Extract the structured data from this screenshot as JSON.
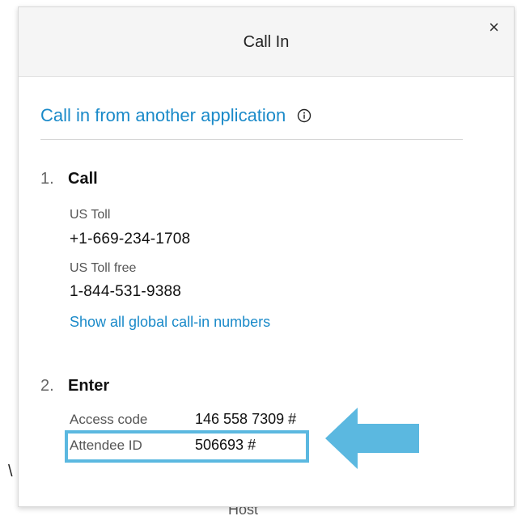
{
  "background": {
    "bottom_text": "Host"
  },
  "dialog": {
    "title": "Call In",
    "close_glyph": "×",
    "section_title": "Call in from another application",
    "step1": {
      "number": "1.",
      "title": "Call",
      "us_toll_label": "US Toll",
      "us_toll_number": "+1-669-234-1708",
      "us_toll_free_label": "US Toll free",
      "us_toll_free_number": "1-844-531-9388",
      "global_link": "Show all global call-in numbers"
    },
    "step2": {
      "number": "2.",
      "title": "Enter",
      "access_code_label": "Access code",
      "access_code_value": "146 558 7309 #",
      "attendee_id_label": "Attendee ID",
      "attendee_id_value": "506693 #"
    }
  },
  "colors": {
    "link": "#1a8ac9",
    "highlight": "#5bb8e0",
    "header_bg": "#f5f5f5"
  },
  "icons": {
    "info": "info-icon",
    "close": "close-icon",
    "annotation": "arrow-left-icon"
  }
}
